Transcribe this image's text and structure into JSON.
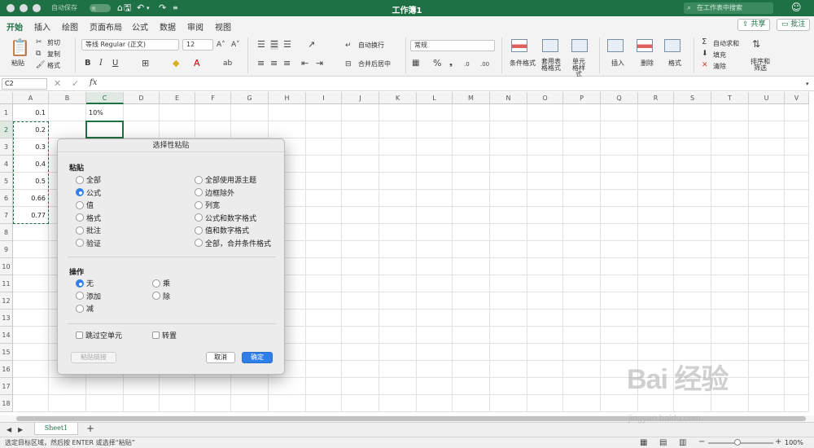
{
  "titlebar": {
    "autosave_label": "自动保存",
    "autosave_state": "关",
    "window_title": "工作簿1",
    "search_placeholder": "在工作表中搜索"
  },
  "menu": {
    "tabs": [
      "开始",
      "插入",
      "绘图",
      "页面布局",
      "公式",
      "数据",
      "审阅",
      "视图"
    ],
    "active_tab": "开始",
    "share_label": "共享",
    "comment_label": "批注"
  },
  "ribbon": {
    "paste_label": "粘贴",
    "cut_label": "剪切",
    "copy_label": "复制",
    "format_painter_label": "格式",
    "font_name": "等线 Regular (正文)",
    "font_size": "12",
    "wrap_text_label": "自动换行",
    "merge_center_label": "合并后居中",
    "number_format": "常规",
    "cond_format_label": "条件格式",
    "table_format_label": "套用表格格式",
    "cell_style_label": "单元格样式",
    "insert_label": "插入",
    "delete_label": "删除",
    "format_label": "格式",
    "autosum_label": "自动求和",
    "fill_label": "填充",
    "clear_label": "清除",
    "sort_filter_label": "排序和筛选"
  },
  "formula_bar": {
    "name_box": "C2",
    "fx_label": "fx",
    "formula": ""
  },
  "grid": {
    "columns": [
      "A",
      "B",
      "C",
      "D",
      "E",
      "F",
      "G",
      "H",
      "I",
      "J",
      "K",
      "L",
      "M",
      "N",
      "O",
      "P",
      "Q",
      "R",
      "S",
      "T",
      "U",
      "V"
    ],
    "rows": [
      "1",
      "2",
      "3",
      "4",
      "5",
      "6",
      "7",
      "8",
      "9",
      "10",
      "11",
      "12",
      "13",
      "14",
      "15",
      "16",
      "17",
      "18"
    ],
    "selected_column": "C",
    "selected_row": "2",
    "cells": [
      {
        "ref": "A1",
        "value": "0.1"
      },
      {
        "ref": "A2",
        "value": "0.2"
      },
      {
        "ref": "A3",
        "value": "0.3"
      },
      {
        "ref": "A4",
        "value": "0.4"
      },
      {
        "ref": "A5",
        "value": "0.5"
      },
      {
        "ref": "A6",
        "value": "0.66"
      },
      {
        "ref": "A7",
        "value": "0.77"
      },
      {
        "ref": "C1",
        "value": "10%"
      }
    ]
  },
  "dialog": {
    "title": "选择性粘贴",
    "paste_section": "粘贴",
    "paste_options_left": [
      "全部",
      "公式",
      "值",
      "格式",
      "批注",
      "验证"
    ],
    "paste_options_right": [
      "全部使用源主题",
      "边框除外",
      "列宽",
      "公式和数字格式",
      "值和数字格式",
      "全部，合并条件格式"
    ],
    "paste_selected": "公式",
    "operation_section": "操作",
    "operation_options_left": [
      "无",
      "添加",
      "减"
    ],
    "operation_options_right": [
      "乘",
      "除"
    ],
    "operation_selected": "无",
    "skip_blanks_label": "跳过空单元",
    "transpose_label": "转置",
    "paste_link_label": "粘贴链接",
    "cancel_label": "取消",
    "ok_label": "确定"
  },
  "sheets": {
    "tabs": [
      "Sheet1"
    ],
    "add_icon": "+"
  },
  "status": {
    "message": "选定目标区域，然后按 ENTER 或选择“粘贴”",
    "zoom": "100%"
  },
  "watermark": {
    "logo_text": "Bai 经验",
    "url": "jingyan.baidu.com"
  },
  "colors": {
    "brand_green": "#1e7145",
    "dialog_blue": "#2f7fea"
  }
}
